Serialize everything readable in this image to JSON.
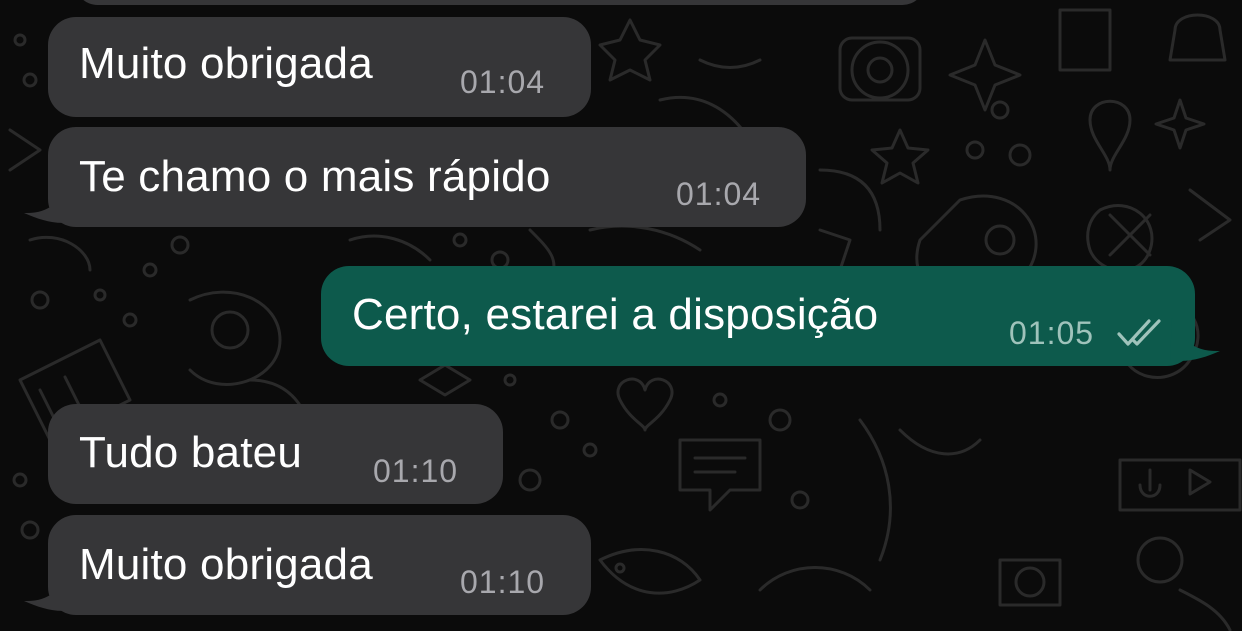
{
  "messages": [
    {
      "direction": "incoming",
      "text": "Muito obrigada",
      "time": "01:04"
    },
    {
      "direction": "incoming",
      "text": "Te chamo o mais rápido",
      "time": "01:04"
    },
    {
      "direction": "outgoing",
      "text": "Certo, estarei a disposição",
      "time": "01:05",
      "status": "read-double-check"
    },
    {
      "direction": "incoming",
      "text": "Tudo bateu",
      "time": "01:10"
    },
    {
      "direction": "incoming",
      "text": "Muito obrigada",
      "time": "01:10"
    }
  ],
  "colors": {
    "background": "#0b0b0b",
    "incoming_bubble": "#363638",
    "outgoing_bubble": "#0d5a4c",
    "timestamp": "#a8a8ad",
    "text": "#ffffff"
  }
}
